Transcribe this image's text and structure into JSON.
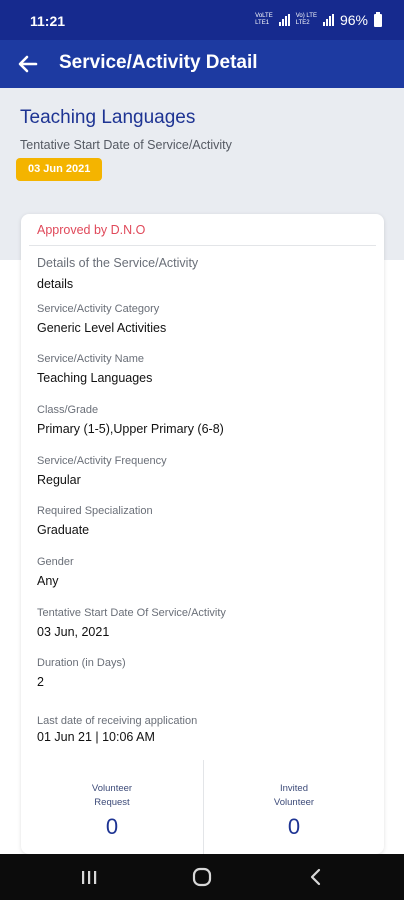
{
  "status_bar": {
    "time": "11:21",
    "net1_top": "VoLTE",
    "net1_bottom": "LTE1",
    "net2_top": "Vo) LTE",
    "net2_bottom": "LTE2",
    "battery": "96%"
  },
  "appbar": {
    "title": "Service/Activity Detail",
    "back_icon": "arrow-left-icon"
  },
  "header": {
    "title": "Teaching Languages",
    "subtitle": "Tentative Start Date of Service/Activity",
    "date_badge": "03 Jun 2021",
    "badge_color": "#f4b400"
  },
  "card": {
    "status": "Approved by D.N.O",
    "status_color": "#e0495a",
    "fields": [
      {
        "label": "Details of the Service/Activity",
        "value": "details"
      },
      {
        "label": "Service/Activity Category",
        "value": "Generic Level Activities"
      },
      {
        "label": "Service/Activity Name",
        "value": "Teaching Languages"
      },
      {
        "label": "Class/Grade",
        "value": "Primary (1-5),Upper Primary (6-8)"
      },
      {
        "label": "Service/Activity Frequency",
        "value": "Regular"
      },
      {
        "label": "Required Specialization",
        "value": "Graduate"
      },
      {
        "label": "Gender",
        "value": "Any"
      },
      {
        "label": "Tentative Start Date Of Service/Activity",
        "value": "03 Jun, 2021"
      },
      {
        "label": "Duration (in Days)",
        "value": "2"
      },
      {
        "label": "Last date of receiving application",
        "value": "01 Jun 21 | 10:06 AM"
      }
    ],
    "stats": [
      {
        "label": "Volunteer\nRequest",
        "value": "0"
      },
      {
        "label": "Invited\nVolunteer",
        "value": "0"
      }
    ]
  },
  "nav_bar": {
    "recents_icon": "recents-icon",
    "home_icon": "home-icon",
    "back_icon": "back-chevron-icon"
  },
  "colors": {
    "status_bar": "#162a8e",
    "app_bar": "#1d3aa1",
    "title_blue": "#1e3493",
    "header_bg": "#e9ecf1"
  }
}
